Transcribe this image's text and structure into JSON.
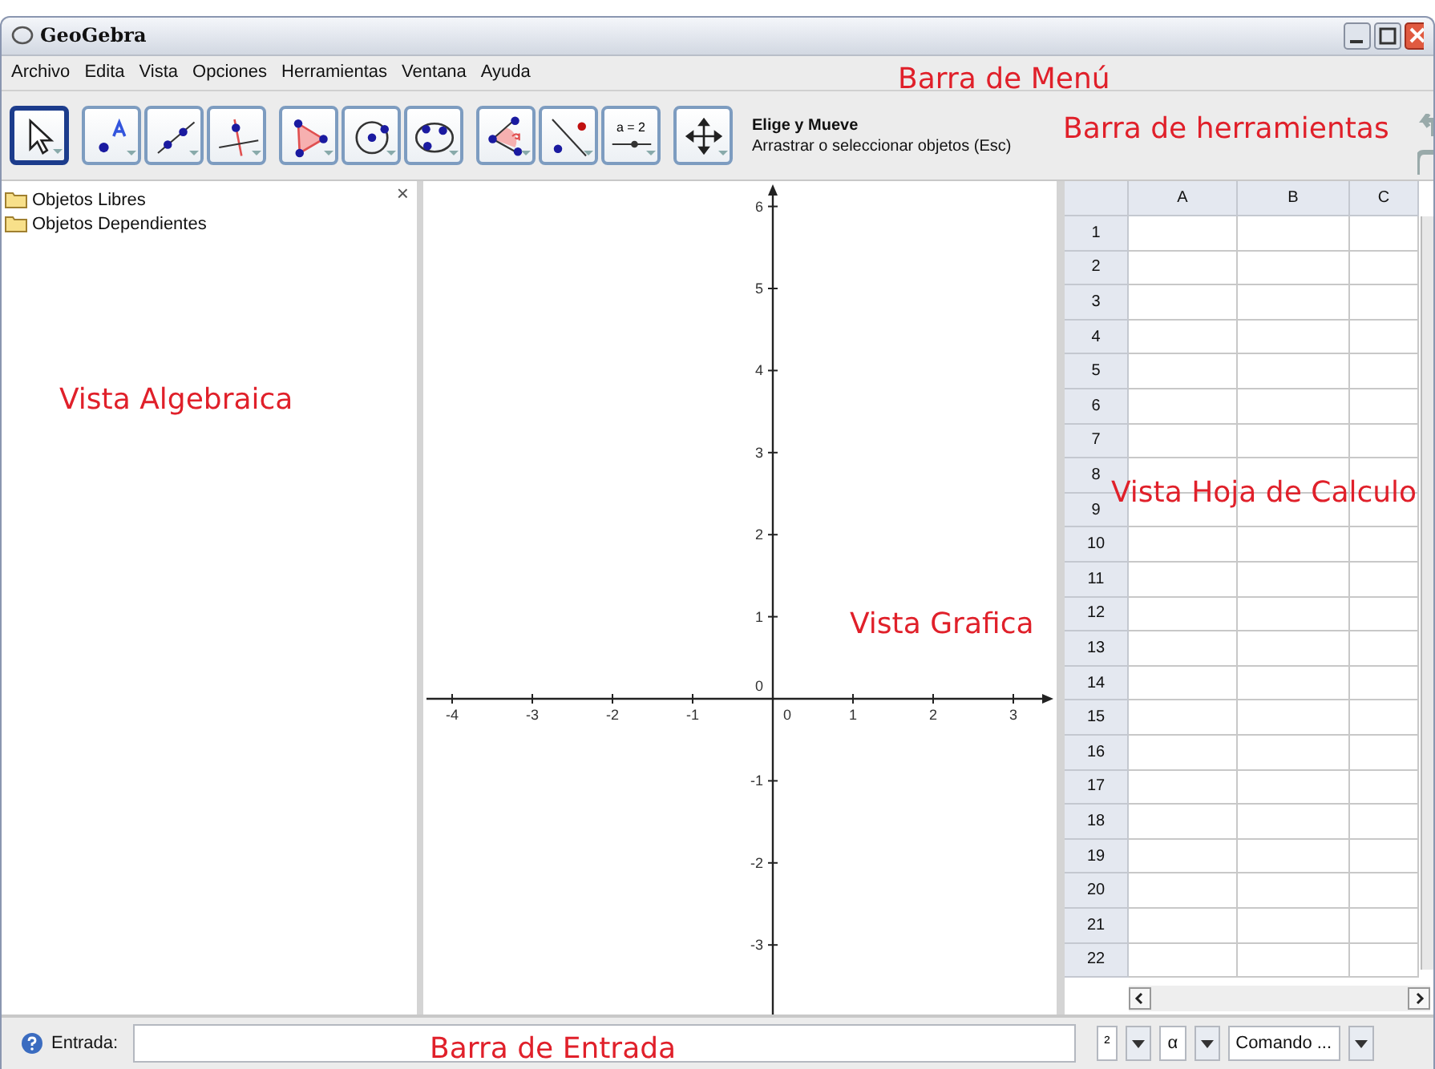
{
  "window": {
    "title": "GeoGebra"
  },
  "menu": [
    "Archivo",
    "Edita",
    "Vista",
    "Opciones",
    "Herramientas",
    "Ventana",
    "Ayuda"
  ],
  "toolbar": {
    "tool_groups": [
      [
        {
          "kind": "move",
          "selected": true
        }
      ],
      [
        {
          "kind": "point",
          "selected": false
        },
        {
          "kind": "line",
          "selected": false
        },
        {
          "kind": "perpendicular",
          "selected": false
        }
      ],
      [
        {
          "kind": "polygon",
          "selected": false
        },
        {
          "kind": "circle",
          "selected": false
        },
        {
          "kind": "conic",
          "selected": false
        }
      ],
      [
        {
          "kind": "angle",
          "selected": false
        },
        {
          "kind": "reflect",
          "selected": false
        },
        {
          "kind": "slider",
          "selected": false,
          "label": "a = 2"
        }
      ],
      [
        {
          "kind": "move_view",
          "selected": false
        }
      ]
    ],
    "tool_name": "Elige y Mueve",
    "tool_help": "Arrastrar o seleccionar objetos (Esc)"
  },
  "algebra_view": {
    "close": "×",
    "folders": [
      "Objetos Libres",
      "Objetos Dependientes"
    ]
  },
  "graphics_view": {
    "x_labels": [
      "-4",
      "-3",
      "-2",
      "-1",
      "0",
      "1",
      "2",
      "3"
    ],
    "y_labels": [
      "6",
      "5",
      "4",
      "3",
      "2",
      "1",
      "0",
      "-1",
      "-2",
      "-3"
    ]
  },
  "spreadsheet": {
    "columns": [
      "A",
      "B",
      "C"
    ],
    "rows": [
      "1",
      "2",
      "3",
      "4",
      "5",
      "6",
      "7",
      "8",
      "9",
      "10",
      "11",
      "12",
      "13",
      "14",
      "15",
      "16",
      "17",
      "18",
      "19",
      "20",
      "21",
      "22"
    ]
  },
  "input_bar": {
    "label": "Entrada:",
    "symbol_menu": "²",
    "greek_menu": "α",
    "command_menu": "Comando ..."
  },
  "annotations": [
    {
      "kind": "menu",
      "text": "Barra de Menú"
    },
    {
      "kind": "toolbar",
      "text": "Barra de herramientas"
    },
    {
      "kind": "algebra",
      "text": "Vista Algebraica"
    },
    {
      "kind": "graphics",
      "text": "Vista Grafica"
    },
    {
      "kind": "spreadsheet",
      "text": "Vista Hoja de Calculo"
    },
    {
      "kind": "input",
      "text": "Barra de Entrada"
    }
  ]
}
